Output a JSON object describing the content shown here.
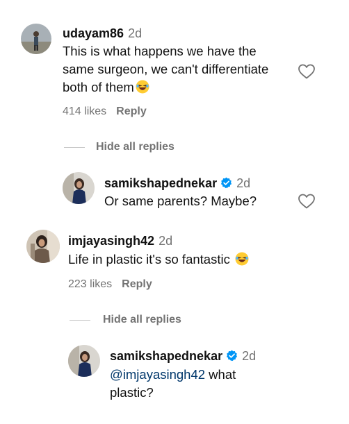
{
  "comments": [
    {
      "username": "udayam86",
      "time": "2d",
      "text_line1": "This is what happens we have the",
      "text_line2": "same surgeon, we can't differentiate",
      "text_line3": "both of them",
      "emoji": "laughing-face",
      "likes": "414 likes",
      "reply": "Reply",
      "hide_replies": "Hide all replies",
      "reply_item": {
        "username": "samikshapednekar",
        "verified": true,
        "time": "2d",
        "text": "Or same parents? Maybe?"
      }
    },
    {
      "username": "imjayasingh42",
      "time": "2d",
      "text": "Life in plastic it's so fantastic",
      "emoji": "laughing-face",
      "likes": "223 likes",
      "reply": "Reply",
      "hide_replies": "Hide all replies",
      "reply_item": {
        "username": "samikshapednekar",
        "verified": true,
        "time": "2d",
        "mention": "@imjayasingh42",
        "text_after_mention": " what",
        "text_line2": "plastic?"
      }
    }
  ],
  "icons": {
    "like": "heart-outline-icon",
    "verified": "verified-badge-icon"
  },
  "colors": {
    "verified_blue": "#0095f6",
    "secondary_text": "#737373",
    "mention": "#00376b"
  }
}
